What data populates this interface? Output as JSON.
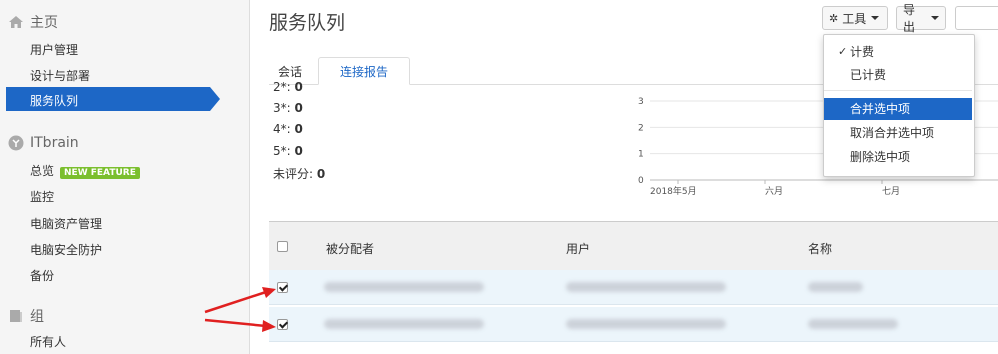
{
  "sidebar": {
    "home": {
      "label": "主页",
      "items": [
        "用户管理",
        "设计与部署",
        "服务队列"
      ]
    },
    "itbrain": {
      "label": "ITbrain",
      "items": [
        "总览",
        "监控",
        "电脑资产管理",
        "电脑安全防护",
        "备份"
      ],
      "badge": "NEW FEATURE"
    },
    "group": {
      "label": "组",
      "items": [
        "所有人"
      ]
    }
  },
  "page": {
    "title": "服务队列"
  },
  "toolbar": {
    "tools_label": "工具",
    "export_label": "导出"
  },
  "tabs": [
    "会话",
    "连接报告"
  ],
  "stats": [
    {
      "label": "2*:",
      "value": "0"
    },
    {
      "label": "3*:",
      "value": "0"
    },
    {
      "label": "4*:",
      "value": "0"
    },
    {
      "label": "5*:",
      "value": "0"
    },
    {
      "label": "未评分:",
      "value": "0"
    }
  ],
  "chart_data": {
    "type": "line",
    "categories": [
      "2018年5月",
      "六月",
      "七月"
    ],
    "y_ticks": [
      "0",
      "1",
      "2",
      "3"
    ],
    "ylim": [
      0,
      3
    ],
    "grid": true
  },
  "menu": {
    "items": [
      {
        "label": "计费",
        "checked": true
      },
      {
        "label": "已计费"
      },
      {
        "label": "合并选中项",
        "highlighted": true
      },
      {
        "label": "取消合并选中项"
      },
      {
        "label": "删除选中项"
      }
    ]
  },
  "table": {
    "headers": [
      "被分配者",
      "用户",
      "名称"
    ],
    "rows": [
      {
        "checked": true
      },
      {
        "checked": true
      }
    ]
  },
  "colors": {
    "accent": "#1d67c6",
    "badge": "#7bbf2e",
    "arrow": "#e02020"
  }
}
